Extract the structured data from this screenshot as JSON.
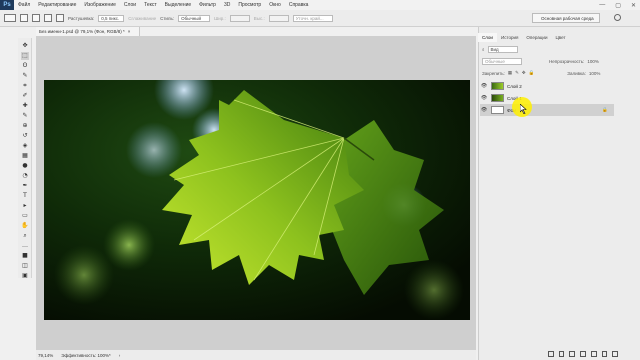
{
  "app": {
    "logo": "Ps"
  },
  "menu": [
    "Файл",
    "Редактирование",
    "Изображение",
    "Слои",
    "Текст",
    "Выделение",
    "Фильтр",
    "3D",
    "Просмотр",
    "Окно",
    "Справка"
  ],
  "window_controls": [
    "—",
    "▢",
    "✕"
  ],
  "options_bar": {
    "feather_label": "Растушевка:",
    "feather_value": "0,5 пикс.",
    "antialias": "Сглаживание",
    "style_label": "Стиль:",
    "style_value": "Обычный",
    "width_label": "Шир.:",
    "height_label": "Выс.:",
    "refine_button": "Уточн. край...",
    "workspace": "Основная рабочая среда"
  },
  "document": {
    "tab_title": "Без имени-1.psd @ 79,1% (Фон, RGB/8) *",
    "zoom": "79,14%",
    "status_label": "Эффективность: 100%*"
  },
  "panels": {
    "tabs": [
      "Слои",
      "История",
      "Операции",
      "Цвет"
    ],
    "active_tab": "Слои",
    "filter_kind": "Вид",
    "blend_mode": "Обычные",
    "opacity_label": "Непрозрачность:",
    "opacity_value": "100%",
    "lock_label": "Закрепить:",
    "fill_label": "Заливка:",
    "fill_value": "100%",
    "layers": [
      {
        "name": "Слой 2",
        "visible": true,
        "selected": false
      },
      {
        "name": "Слой 1",
        "visible": true,
        "selected": false
      },
      {
        "name": "Фон",
        "visible": true,
        "selected": true,
        "locked": true
      }
    ]
  },
  "icons": {
    "tools": [
      "move-icon",
      "marquee-icon",
      "lasso-icon",
      "quick-select-icon",
      "crop-icon",
      "eyedropper-icon",
      "healing-icon",
      "brush-icon",
      "stamp-icon",
      "history-brush-icon",
      "eraser-icon",
      "gradient-icon",
      "blur-icon",
      "dodge-icon",
      "pen-icon",
      "type-icon",
      "path-select-icon",
      "shape-icon",
      "hand-icon",
      "zoom-icon",
      "more-icon",
      "colors-icon",
      "quickmask-icon",
      "screenmode-icon"
    ],
    "tool_glyphs": [
      "✥",
      "⬚",
      "ʘ",
      "✎",
      "⌗",
      "✐",
      "✚",
      "✎",
      "⊕",
      "↺",
      "◈",
      "▦",
      "●",
      "◔",
      "✒",
      "T",
      "▸",
      "▭",
      "✋",
      "⌕",
      "…",
      "■",
      "◫",
      "▣"
    ]
  },
  "colors": {
    "accent_cursor": "#fff000",
    "ui_bg": "#ececec",
    "canvas_bg": "#cfcfcf"
  }
}
